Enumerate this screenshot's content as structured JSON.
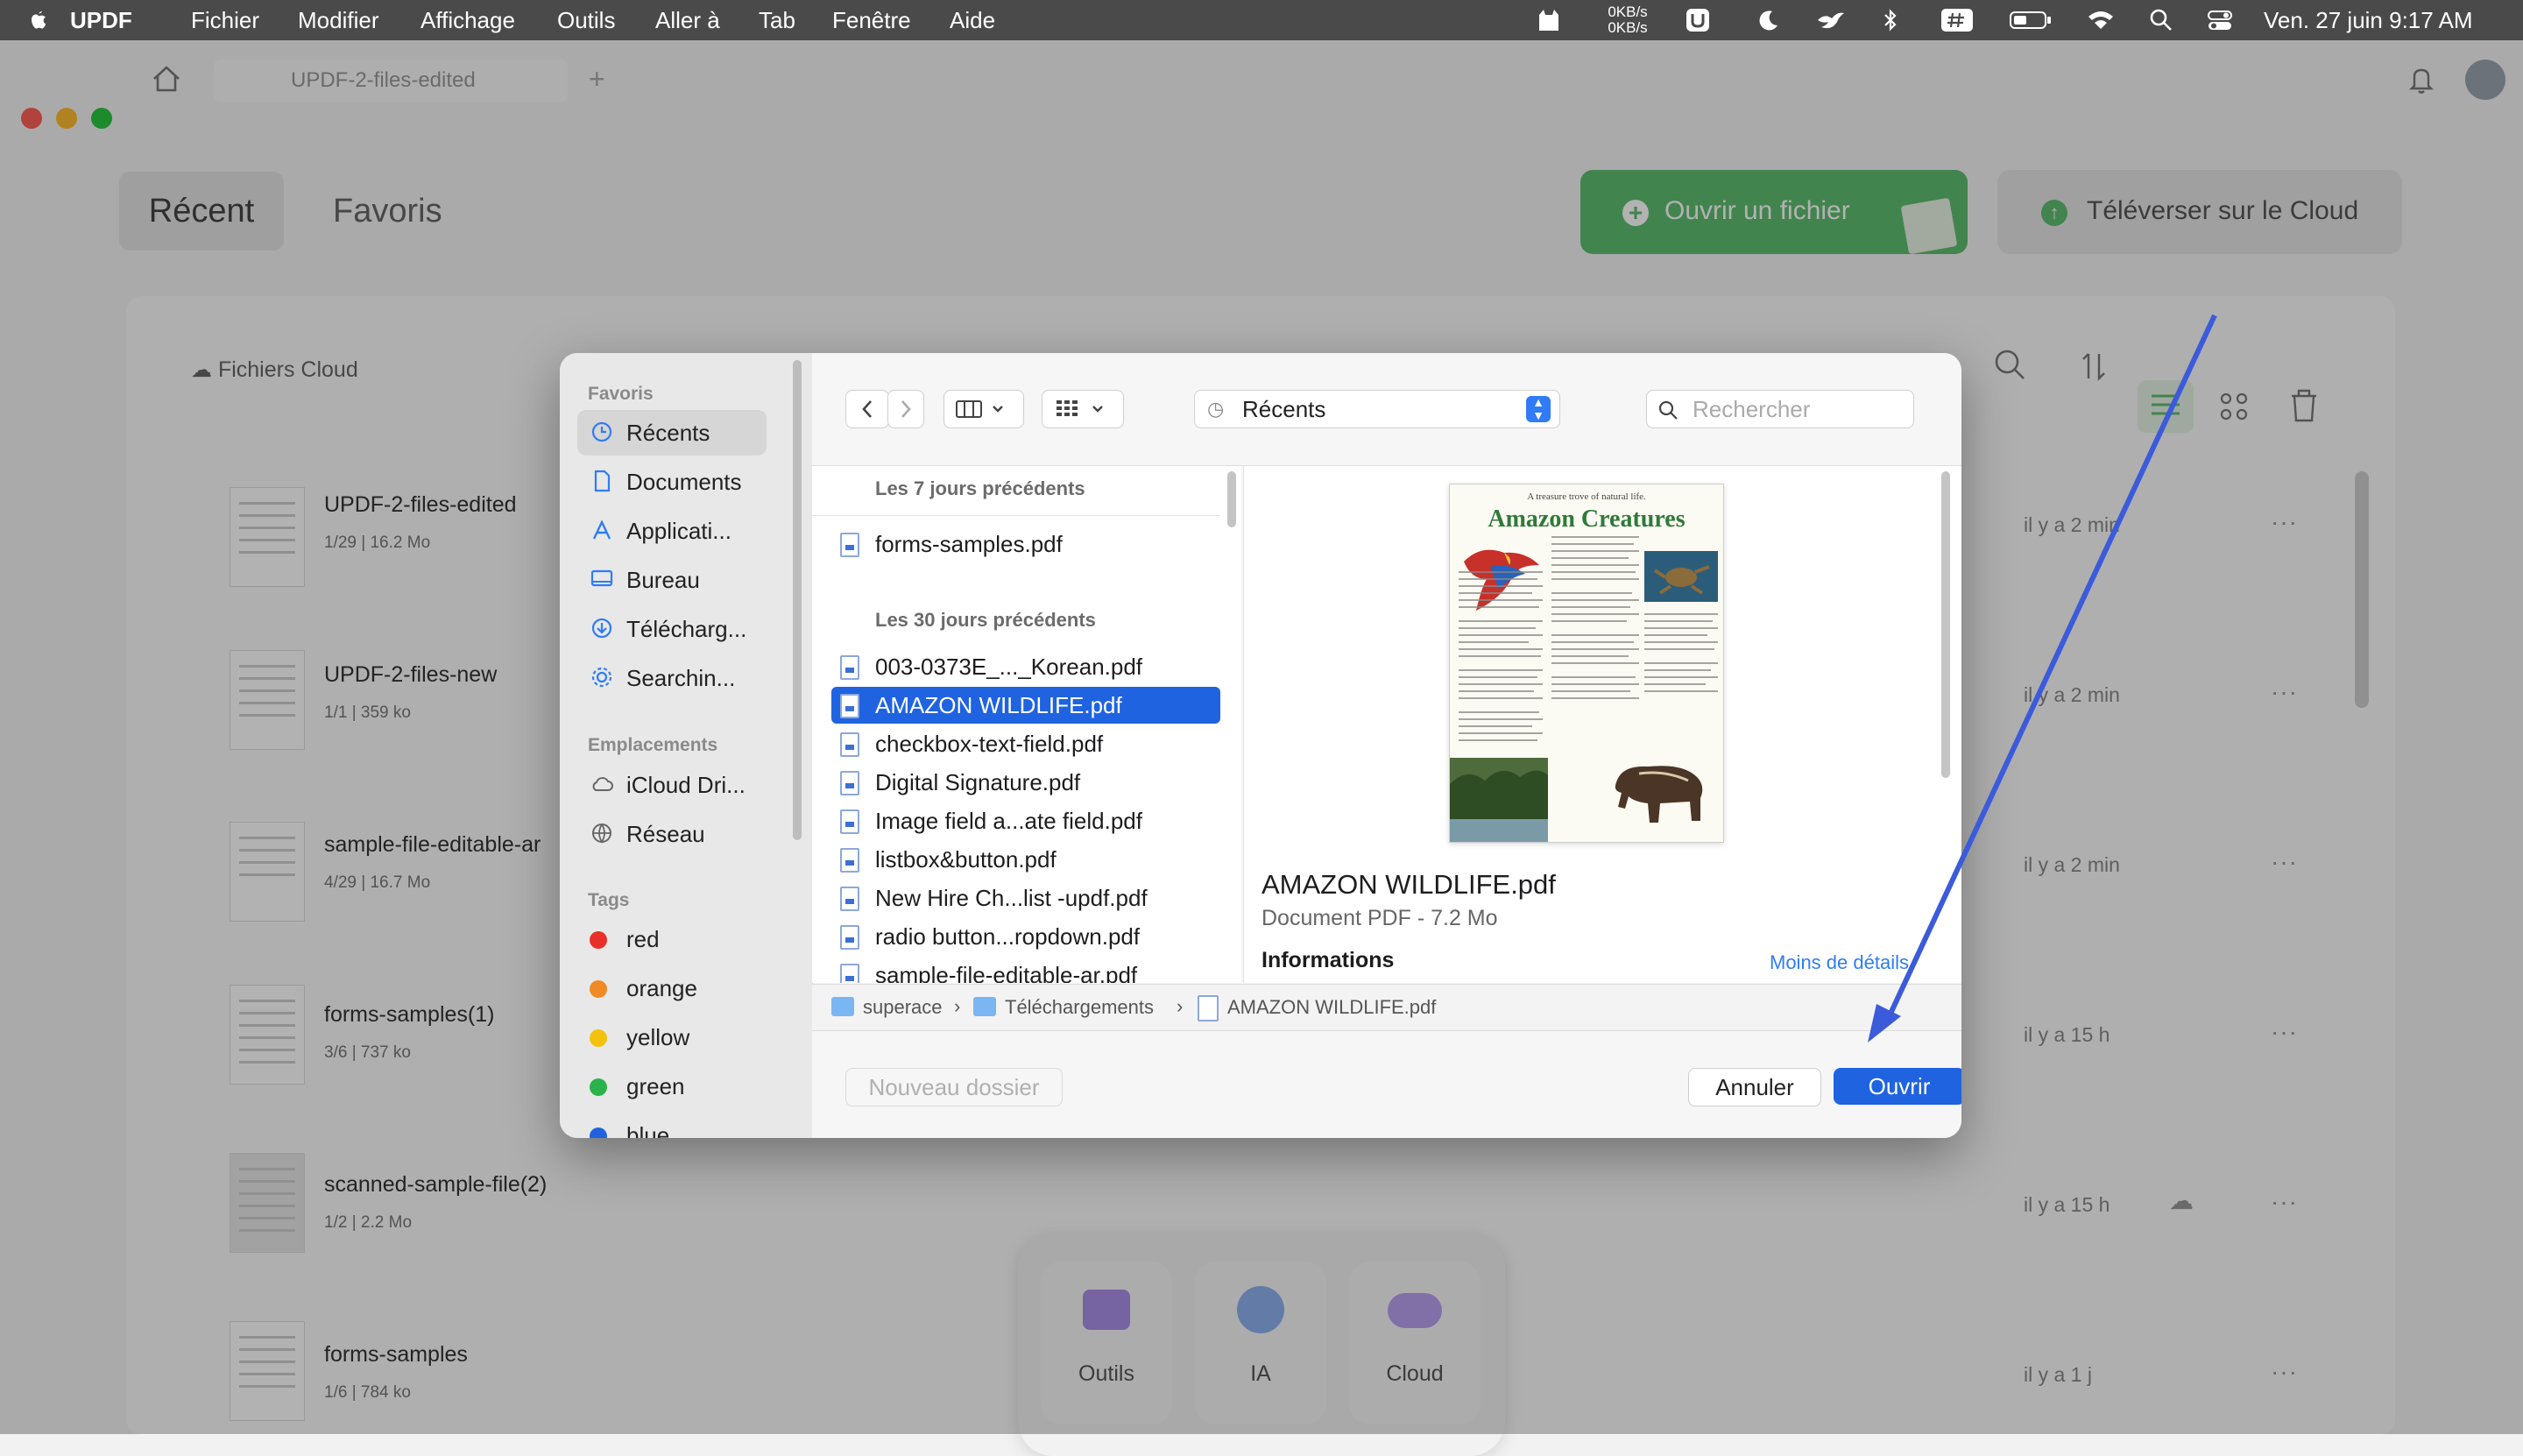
{
  "menubar": {
    "app_name": "UPDF",
    "items": [
      "Fichier",
      "Modifier",
      "Affichage",
      "Outils",
      "Aller à",
      "Tab",
      "Fenêtre",
      "Aide"
    ],
    "net_up": "0KB/s",
    "net_down": "0KB/s",
    "clock": "Ven. 27 juin  9:17 AM"
  },
  "app": {
    "tab_title": "UPDF-2-files-edited",
    "tabs": {
      "recent": "Récent",
      "favorites": "Favoris"
    },
    "open_file_button": "Ouvrir un fichier",
    "upload_cloud_button": "Téléverser sur le Cloud",
    "cloud_files_label": "Fichiers Cloud",
    "files": [
      {
        "name": "UPDF-2-files-edited",
        "pages": "1/29",
        "size": "16.2 Mo",
        "time": "il y a 2 min"
      },
      {
        "name": "UPDF-2-files-new",
        "pages": "1/1",
        "size": "359 ko",
        "time": "il y a 2 min"
      },
      {
        "name": "sample-file-editable-ar",
        "pages": "4/29",
        "size": "16.7 Mo",
        "time": "il y a 2 min"
      },
      {
        "name": "forms-samples(1)",
        "pages": "3/6",
        "size": "737 ko",
        "time": "il y a 15 h"
      },
      {
        "name": "scanned-sample-file(2)",
        "pages": "1/2",
        "size": "2.2 Mo",
        "time": "il y a 15 h"
      },
      {
        "name": "forms-samples",
        "pages": "1/6",
        "size": "784 ko",
        "time": "il y a 1 j"
      }
    ],
    "dock": {
      "tools": "Outils",
      "ai": "IA",
      "cloud": "Cloud"
    }
  },
  "dialog": {
    "sidebar": {
      "favorites_header": "Favoris",
      "favorites": [
        {
          "label": "Récents",
          "icon": "clock-icon"
        },
        {
          "label": "Documents",
          "icon": "document-icon"
        },
        {
          "label": "Applicati...",
          "icon": "applications-icon"
        },
        {
          "label": "Bureau",
          "icon": "desktop-icon"
        },
        {
          "label": "Télécharg...",
          "icon": "download-icon"
        },
        {
          "label": "Searchin...",
          "icon": "gear-icon"
        }
      ],
      "locations_header": "Emplacements",
      "locations": [
        {
          "label": "iCloud Dri...",
          "icon": "cloud-icon"
        },
        {
          "label": "Réseau",
          "icon": "globe-icon"
        }
      ],
      "tags_header": "Tags",
      "tags": [
        {
          "label": "red",
          "color": "#e8302a"
        },
        {
          "label": "orange",
          "color": "#f08a24"
        },
        {
          "label": "yellow",
          "color": "#f4c20d"
        },
        {
          "label": "green",
          "color": "#2bb24c"
        },
        {
          "label": "blue",
          "color": "#1f63e0"
        }
      ]
    },
    "toolbar": {
      "location": "Récents",
      "search_placeholder": "Rechercher"
    },
    "groups": [
      {
        "title": "Les 7 jours précédents",
        "files": [
          "forms-samples.pdf"
        ]
      },
      {
        "title": "Les 30 jours précédents",
        "files": [
          "003-0373E_..._Korean.pdf",
          "AMAZON WILDLIFE.pdf",
          "checkbox-text-field.pdf",
          "Digital Signature.pdf",
          "Image field a...ate field.pdf",
          "listbox&button.pdf",
          "New Hire Ch...list -updf.pdf",
          "radio button...ropdown.pdf",
          "sample-file-editable-ar.pdf"
        ]
      }
    ],
    "selected_file": "AMAZON WILDLIFE.pdf",
    "preview": {
      "doc_tagline": "A treasure trove of natural life.",
      "doc_title": "Amazon Creatures",
      "file_name": "AMAZON WILDLIFE.pdf",
      "file_kind": "Document PDF - 7.2 Mo",
      "info_label": "Informations",
      "less_details": "Moins de détails"
    },
    "path": [
      "superace",
      "Téléchargements",
      "AMAZON WILDLIFE.pdf"
    ],
    "new_folder_button": "Nouveau dossier",
    "cancel_button": "Annuler",
    "open_button": "Ouvrir"
  },
  "colors": {
    "accent": "#1f63e0",
    "open_button_green": "#2bb24c",
    "annotation_arrow": "#3b5bdb"
  }
}
